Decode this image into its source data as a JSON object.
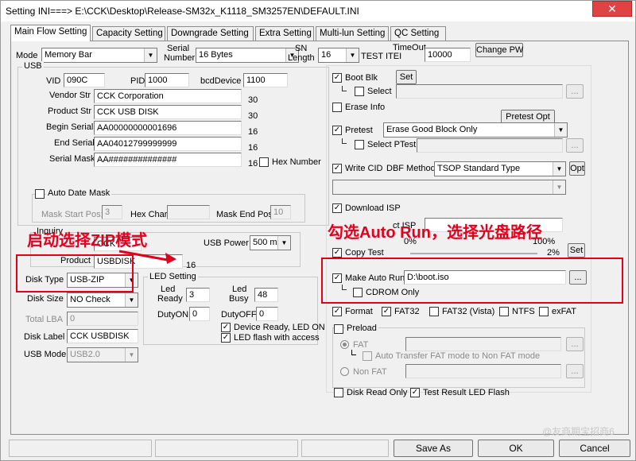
{
  "window": {
    "title": "Setting  INI===> E:\\CCK\\Desktop\\Release-SM32x_K1118_SM3257EN\\DEFAULT.INI",
    "close": "✕"
  },
  "tabs": [
    "Main Flow Setting",
    "Capacity Setting",
    "Downgrade Setting",
    "Extra Setting",
    "Multi-lun Setting",
    "QC Setting"
  ],
  "top": {
    "mode_label": "Mode",
    "mode_value": "Memory Bar",
    "serial_number_label": [
      "Serial",
      "Number"
    ],
    "serial_number_value": "16 Bytes",
    "sn_length_label": [
      "SN",
      "Length"
    ],
    "sn_length_value": "16",
    "test_item_label": "TEST ITEI",
    "timeout_label": "TimeOut",
    "timeout_value": "10000",
    "change_pw": "Change PW"
  },
  "usb": {
    "group": "USB",
    "vid_label": "VID",
    "vid": "090C",
    "pid_label": "PID",
    "pid": "1000",
    "bcd_label": "bcdDevice",
    "bcd": "1100",
    "vendor_label": "Vendor Str",
    "vendor": "CCK Corporation",
    "vendor_len": "30",
    "product_label": "Product Str",
    "product": "CCK USB DISK",
    "product_len": "30",
    "begin_label": "Begin Serial",
    "begin": "AA00000000001696",
    "begin_len": "16",
    "end_label": "End Serial",
    "end": "AA04012799999999",
    "end_len": "16",
    "mask_label": "Serial Mask",
    "mask": "AA##############",
    "mask_len": "16",
    "hex_number": "Hex Number",
    "auto_date_mask": "Auto Date Mask",
    "mask_start_label": "Mask Start Pos:",
    "mask_start": "3",
    "hex_char_label": "Hex Char:",
    "hex_char": "",
    "mask_end_label": "Mask End Pos:",
    "mask_end": "10"
  },
  "inquiry": {
    "group": "Inquiry",
    "vendor_partial": "CCK",
    "product_label": "Product",
    "product": "USBDISK",
    "product_len": "16",
    "usb_power_label": "USB Power",
    "usb_power": "500 mA"
  },
  "disk": {
    "type_label": "Disk Type",
    "type": "USB-ZIP",
    "size_label": "Disk Size",
    "size": "NO Check",
    "total_lba_label": "Total LBA",
    "total_lba": "0",
    "label_label": "Disk Label",
    "label": "CCK USBDISK",
    "usb_mode_label": "USB Mode",
    "usb_mode": "USB2.0"
  },
  "led": {
    "group": "LED Setting",
    "ready_label": [
      "Led",
      "Ready"
    ],
    "ready": "3",
    "busy_label": [
      "Led",
      "Busy"
    ],
    "busy": "48",
    "duty_on_label": "DutyON",
    "duty_on": "0",
    "duty_off_label": "DutyOFF",
    "duty_off": "0",
    "device_ready": "Device Ready, LED ON",
    "led_flash": "LED flash with access"
  },
  "right": {
    "boot_blk": "Boot Blk",
    "set": "Set",
    "select": "Select",
    "browse": "...",
    "erase_info": "Erase Info",
    "pretest_opt": "Pretest Opt",
    "pretest": "Pretest",
    "pretest_value": "Erase Good Block Only",
    "select_ptest": "Select PTest",
    "write_cid": "Write CID",
    "dbf_method": "DBF Method",
    "dbf_value": "TSOP Standard Type",
    "opt": "Opt",
    "download_isp": "Download ISP",
    "select_isp_partial": "ct ISP",
    "copy_test": "Copy Test",
    "pct_0": "0%",
    "pct_100": "100%",
    "pct_2": "2%",
    "copy_set": "Set",
    "make_auto_run": "Make Auto Run",
    "auto_run_path": "D:\\boot.iso",
    "cdrom_only": "CDROM Only",
    "format": "Format",
    "fat32": "FAT32",
    "fat32_vista": "FAT32 (Vista)",
    "ntfs": "NTFS",
    "exfat": "exFAT",
    "preload": "Preload",
    "fat": "FAT",
    "auto_transfer": "Auto Transfer FAT mode to Non FAT mode",
    "non_fat": "Non FAT",
    "disk_read_only": "Disk Read Only",
    "test_result_led": "Test Result LED Flash"
  },
  "footer": {
    "save_as": "Save As",
    "ok": "OK",
    "cancel": "Cancel"
  },
  "annotations": {
    "left": "启动选择ZIP模式",
    "right": "勾选Auto Run，选择光盘路径"
  },
  "watermark": "@友商期宝招商6",
  "colors": {
    "annotation_red": "#e3001b"
  }
}
